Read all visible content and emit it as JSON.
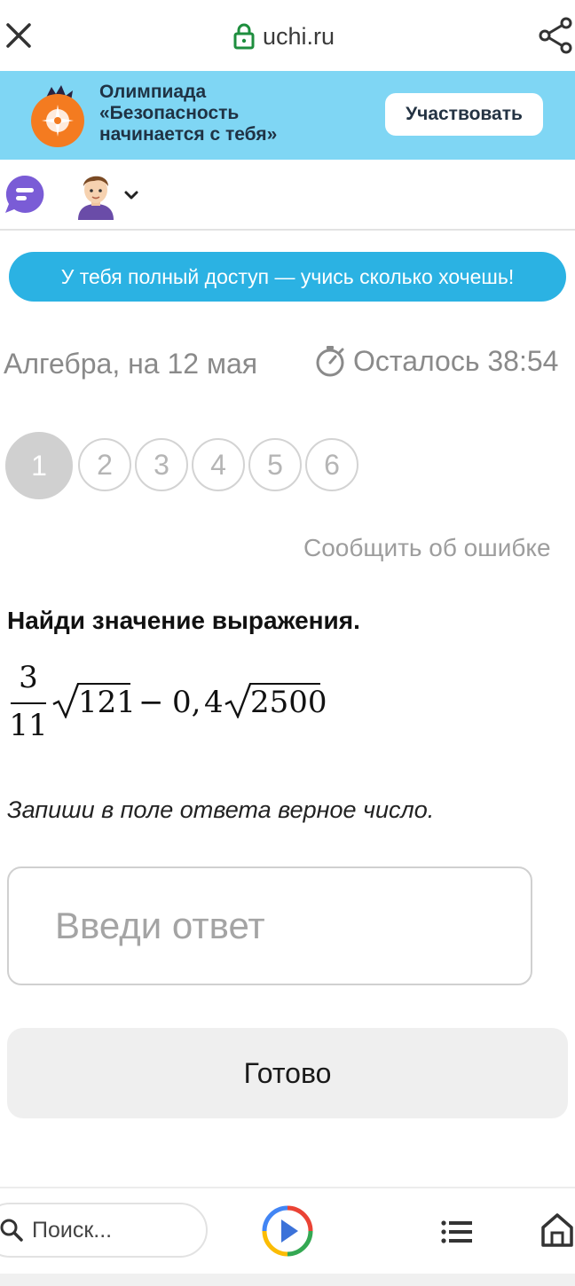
{
  "browser": {
    "url": "uchi.ru",
    "search_placeholder": "Поиск..."
  },
  "banner": {
    "title": "Олимпиада\n«Безопасность\nначинается с тебя»",
    "join_label": "Участвовать"
  },
  "access_message": "У тебя полный доступ — учись сколько хочешь!",
  "lesson": {
    "subject": "Алгебра, на 12 мая",
    "timer": "Осталось 38:54"
  },
  "steps": [
    {
      "label": "1",
      "active": true
    },
    {
      "label": "2",
      "active": false
    },
    {
      "label": "3",
      "active": false
    },
    {
      "label": "4",
      "active": false
    },
    {
      "label": "5",
      "active": false
    },
    {
      "label": "6",
      "active": false
    }
  ],
  "report_label": "Сообщить об ошибке",
  "task": {
    "title": "Найди значение выражения.",
    "expression": {
      "numerator": "3",
      "denominator": "11",
      "radicand_1": "121",
      "operator": "−",
      "coefficient": "0,",
      "coefficient_2": "4",
      "radicand_2": "2500"
    },
    "instruction": "Запиши в поле ответа верное число.",
    "answer_placeholder": "Введи ответ",
    "answer_value": "",
    "submit_label": "Готово"
  },
  "colors": {
    "banner_bg": "#7fd6f4",
    "access_pill": "#2bb2e3",
    "lock_green": "#1e8e3e",
    "chat_purple": "#7a5cd6",
    "active_step": "#d0d0d0"
  }
}
